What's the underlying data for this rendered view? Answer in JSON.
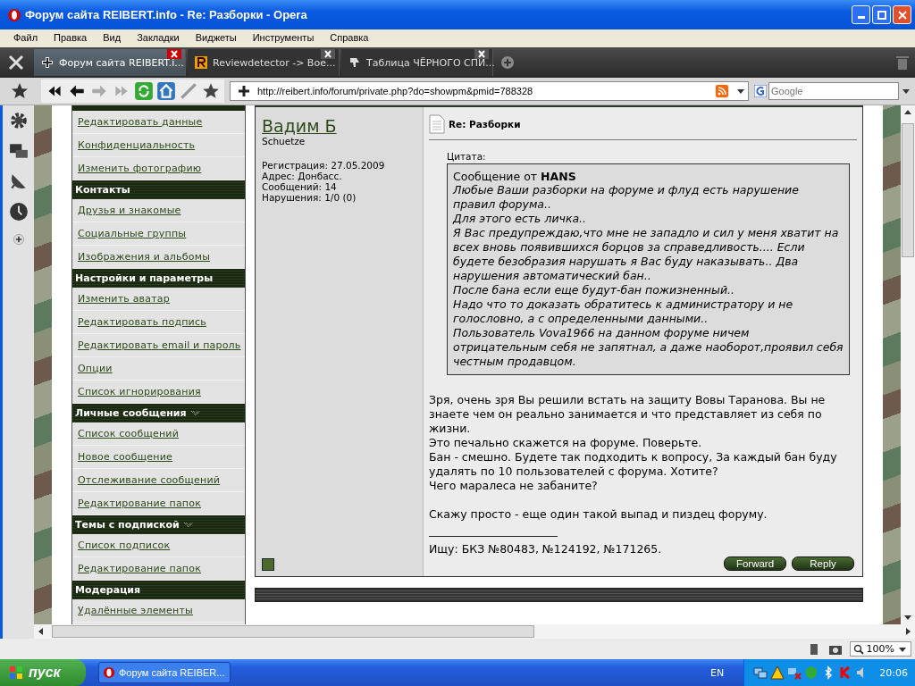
{
  "window": {
    "title": "Форум сайта REIBERT.info - Re: Разборки - Opera"
  },
  "menu": [
    "Файл",
    "Правка",
    "Вид",
    "Закладки",
    "Виджеты",
    "Инструменты",
    "Справка"
  ],
  "tabs": [
    {
      "label": "Форум сайта REIBERT.i...",
      "selected": true
    },
    {
      "label": "Reviewdetector -> Вое...",
      "selected": false
    },
    {
      "label": "Таблица ЧЁРНОГО СПИ...",
      "selected": false
    }
  ],
  "address": {
    "url": "http://reibert.info/forum/private.php?do=showpm&pmid=788328",
    "search_placeholder": "Google"
  },
  "sidebar": [
    {
      "kind": "link",
      "label": "Редактировать данные"
    },
    {
      "kind": "link",
      "label": "Конфиденциальность"
    },
    {
      "kind": "link",
      "label": "Изменить фотографию"
    },
    {
      "kind": "header",
      "label": "Контакты",
      "collapsible": false
    },
    {
      "kind": "link",
      "label": "Друзья и знакомые"
    },
    {
      "kind": "link",
      "label": "Социальные группы"
    },
    {
      "kind": "link",
      "label": "Изображения и альбомы"
    },
    {
      "kind": "header",
      "label": "Настройки и параметры",
      "collapsible": false
    },
    {
      "kind": "link",
      "label": "Изменить аватар"
    },
    {
      "kind": "link",
      "label": "Редактировать подпись"
    },
    {
      "kind": "link",
      "label": "Редактировать email и пароль"
    },
    {
      "kind": "link",
      "label": "Опции"
    },
    {
      "kind": "link",
      "label": "Список игнорирования"
    },
    {
      "kind": "header",
      "label": "Личные сообщения",
      "collapsible": true
    },
    {
      "kind": "link",
      "label": "Список сообщений"
    },
    {
      "kind": "link",
      "label": "Новое сообщение"
    },
    {
      "kind": "link",
      "label": "Отслеживание сообщений"
    },
    {
      "kind": "link",
      "label": "Редактирование папок"
    },
    {
      "kind": "header",
      "label": "Темы с подпиской",
      "collapsible": true
    },
    {
      "kind": "link",
      "label": "Список подписок"
    },
    {
      "kind": "link",
      "label": "Редактирование папок"
    },
    {
      "kind": "header",
      "label": "Модерация",
      "collapsible": false
    },
    {
      "kind": "link",
      "label": "Удалённые элементы"
    }
  ],
  "post": {
    "author": "Вадим Б",
    "rank": "Schuetze",
    "details": [
      "Регистрация: 27.05.2009",
      "Адрес: Донбасс.",
      "Сообщений: 14",
      "Нарушения: 1/0 (0)"
    ],
    "title": "Re: Разборки",
    "quote_label": "Цитата:",
    "quote_from": "Сообщение от **HANS**",
    "quote_lines": [
      "Любые Ваши разборки на форуме и флуд есть нарушение правил форума..",
      "Для этого есть личка..",
      "Я Вас предупреждаю,что мне не западло и сил у меня хватит на всех вновь появившихся борцов за справедливость.... Если будете безобразия нарушать я Вас буду наказывать.. Два нарушения автоматический бан..",
      "После бана если еще будут-бан пожизненный..",
      "Надо что то доказать обратитесь к администратору и не голословно, а с определенными данными..",
      "Пользователь Vova1966 на данном форуме ничем отрицательным себя не запятнал, а даже наоборот,проявил себя честным продавцом."
    ],
    "body": [
      [
        "Зря, очень зря Вы решили встать на защиту Вовы Таранова. Вы не знаете чем он реально занимается и что представляет из себя по жизни.",
        "Это печально скажется на форуме. Поверьте.",
        "Бан - смешно. Будете так подходить к вопросу, За каждый бан буду удалять по 10 пользователей с форума. Хотите?",
        "Чего маралеса не забаните?"
      ],
      [
        "Скажу просто - еще один такой выпад и пиздец форуму."
      ]
    ],
    "signature": "Ищу: БКЗ №80483, №124192, №171265.",
    "buttons": [
      "Forward",
      "Reply"
    ]
  },
  "status_bar": {
    "zoom": "100%"
  },
  "taskbar": {
    "start": "пуск",
    "tasks": [
      "Форум сайта REIBER..."
    ],
    "language": "EN",
    "clock": "20:06"
  }
}
